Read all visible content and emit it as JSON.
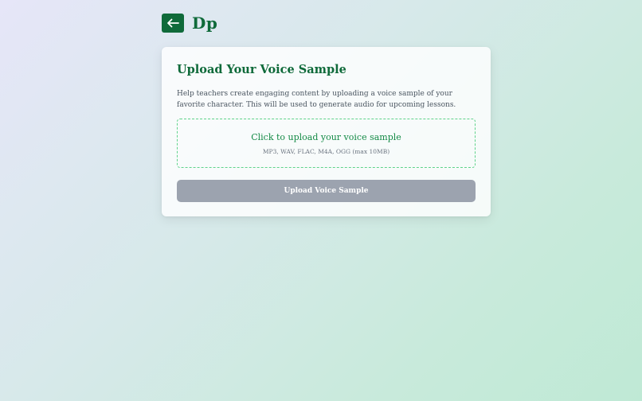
{
  "header": {
    "back_icon": "arrow-left-icon",
    "brand": "Dp"
  },
  "card": {
    "title": "Upload Your Voice Sample",
    "description": "Help teachers create engaging content by uploading a voice sample of your favorite character. This will be used to generate audio for upcoming lessons.",
    "dropzone": {
      "main_text": "Click to upload your voice sample",
      "sub_text": "MP3, WAV, FLAC, M4A, OGG (max 10MB)"
    },
    "upload_button_label": "Upload Voice Sample"
  },
  "colors": {
    "brand_green": "#0f6a3a",
    "dropzone_border": "#5fd38a",
    "button_disabled": "#9ca3af"
  }
}
